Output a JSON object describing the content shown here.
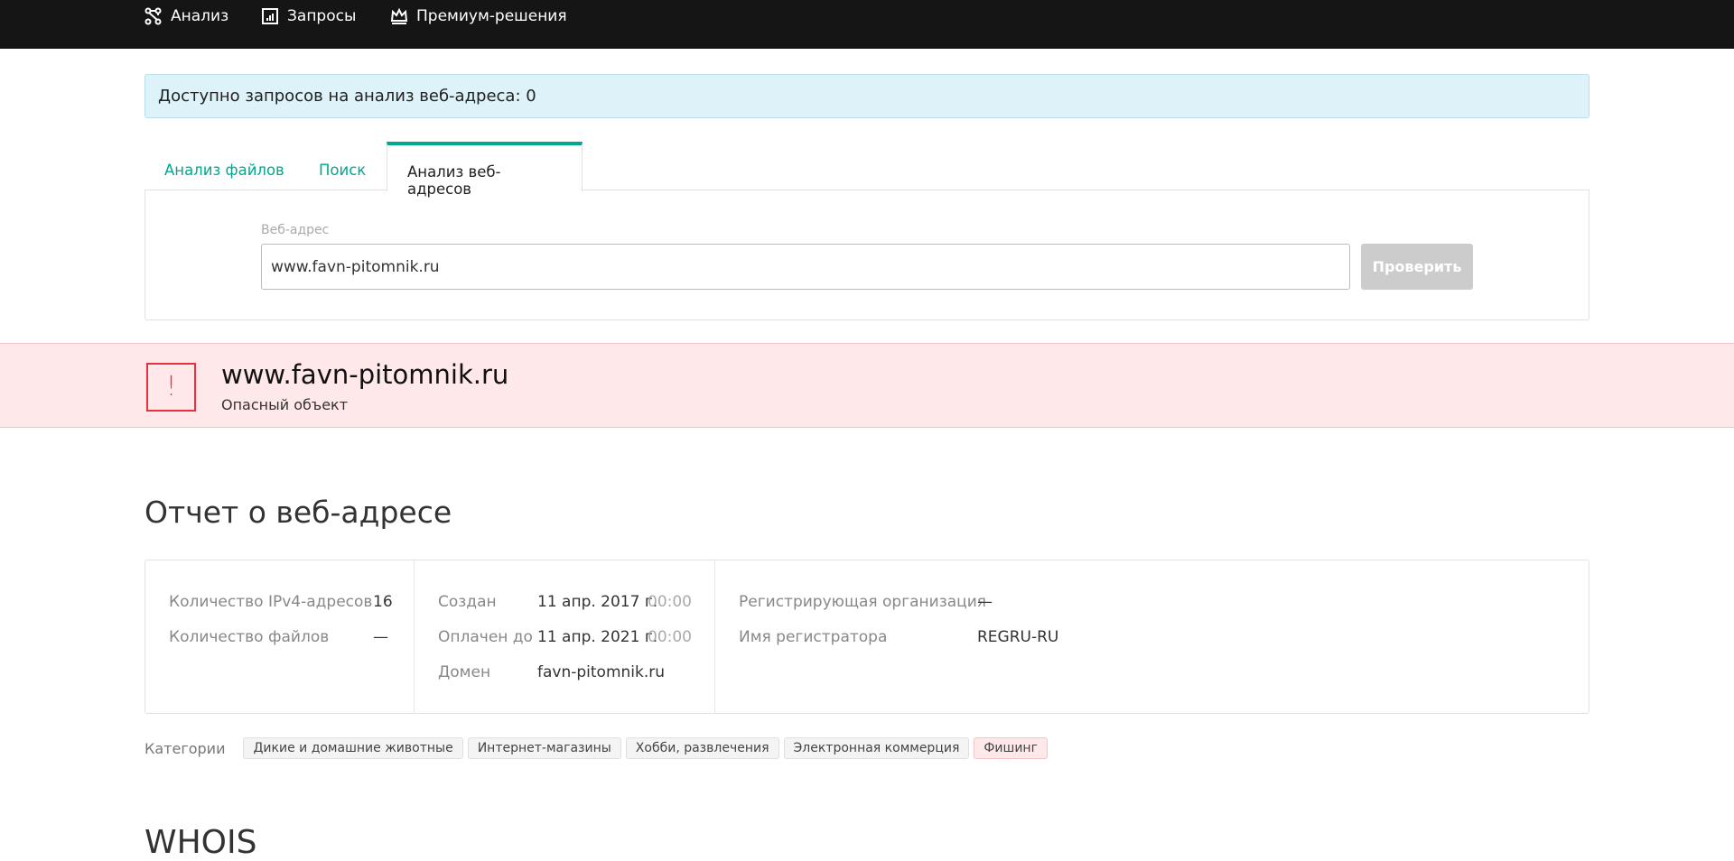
{
  "nav": [
    {
      "label": "Анализ",
      "icon": "graph-icon"
    },
    {
      "label": "Запросы",
      "icon": "report-icon"
    },
    {
      "label": "Премиум-решения",
      "icon": "crown-icon"
    }
  ],
  "info": "Доступно запросов на анализ веб-адреса: 0",
  "tabs": [
    "Анализ файлов",
    "Поиск",
    "Анализ веб-адресов"
  ],
  "form": {
    "label": "Веб-адрес",
    "value": "www.favn-pitomnik.ru",
    "button": "Проверить"
  },
  "verdict": {
    "url": "www.favn-pitomnik.ru",
    "status": "Опасный объект",
    "icon_glyph": "!",
    "color": "#e8313f"
  },
  "report": {
    "title": "Отчет о веб-адресе",
    "ipv4_label": "Количество IPv4-адресов",
    "ipv4_value": "16",
    "files_label": "Количество файлов",
    "files_value": "—",
    "created_label": "Создан",
    "created_date": "11 апр. 2017 г.",
    "created_time": "00:00",
    "paid_label": "Оплачен до",
    "paid_date": "11 апр. 2021 г.",
    "paid_time": "00:00",
    "domain_label": "Домен",
    "domain_value": "favn-pitomnik.ru",
    "org_label": "Регистрирующая организация",
    "org_value": "—",
    "registrar_label": "Имя регистратора",
    "registrar_value": "REGRU-RU"
  },
  "categories": {
    "label": "Категории",
    "items": [
      "Дикие и домашние животные",
      "Интернет-магазины",
      "Хобби, развлечения",
      "Электронная коммерция",
      "Фишинг"
    ]
  },
  "whois_title": "WHOIS"
}
